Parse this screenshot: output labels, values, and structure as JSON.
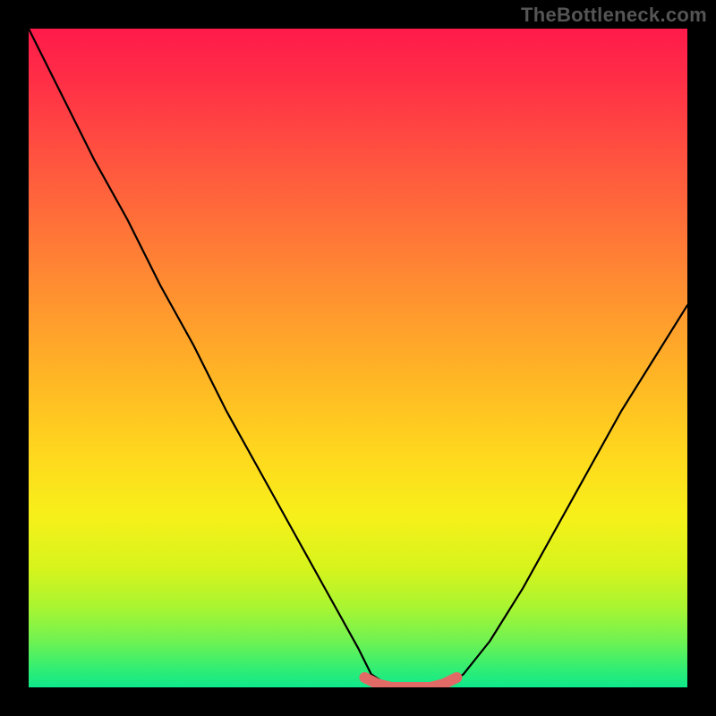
{
  "watermark": "TheBottleneck.com",
  "chart_data": {
    "type": "line",
    "title": "",
    "xlabel": "",
    "ylabel": "",
    "xlim": [
      0,
      100
    ],
    "ylim": [
      0,
      100
    ],
    "series": [
      {
        "name": "black-curve",
        "x": [
          0,
          5,
          10,
          15,
          20,
          25,
          30,
          35,
          40,
          45,
          50,
          52,
          55,
          58,
          60,
          63,
          66,
          70,
          75,
          80,
          85,
          90,
          95,
          100
        ],
        "values": [
          100,
          90,
          80,
          71,
          61,
          52,
          42,
          33,
          24,
          15,
          6,
          2,
          0,
          0,
          0,
          0,
          2,
          7,
          15,
          24,
          33,
          42,
          50,
          58
        ]
      },
      {
        "name": "red-trough-marker",
        "x": [
          51,
          53,
          55,
          57,
          59,
          61,
          63,
          65
        ],
        "values": [
          1.5,
          0.5,
          0,
          0,
          0,
          0,
          0.5,
          1.5
        ]
      }
    ],
    "background_gradient_stops": [
      {
        "pct": 0,
        "color": "#ff1a4a"
      },
      {
        "pct": 8,
        "color": "#ff2f46"
      },
      {
        "pct": 22,
        "color": "#ff5a3e"
      },
      {
        "pct": 38,
        "color": "#ff8a32"
      },
      {
        "pct": 52,
        "color": "#ffb326"
      },
      {
        "pct": 64,
        "color": "#ffd61e"
      },
      {
        "pct": 74,
        "color": "#f7f01a"
      },
      {
        "pct": 82,
        "color": "#d6f41c"
      },
      {
        "pct": 88,
        "color": "#a8f532"
      },
      {
        "pct": 93,
        "color": "#6ff252"
      },
      {
        "pct": 97,
        "color": "#34ee72"
      },
      {
        "pct": 100,
        "color": "#0ee98b"
      }
    ]
  }
}
